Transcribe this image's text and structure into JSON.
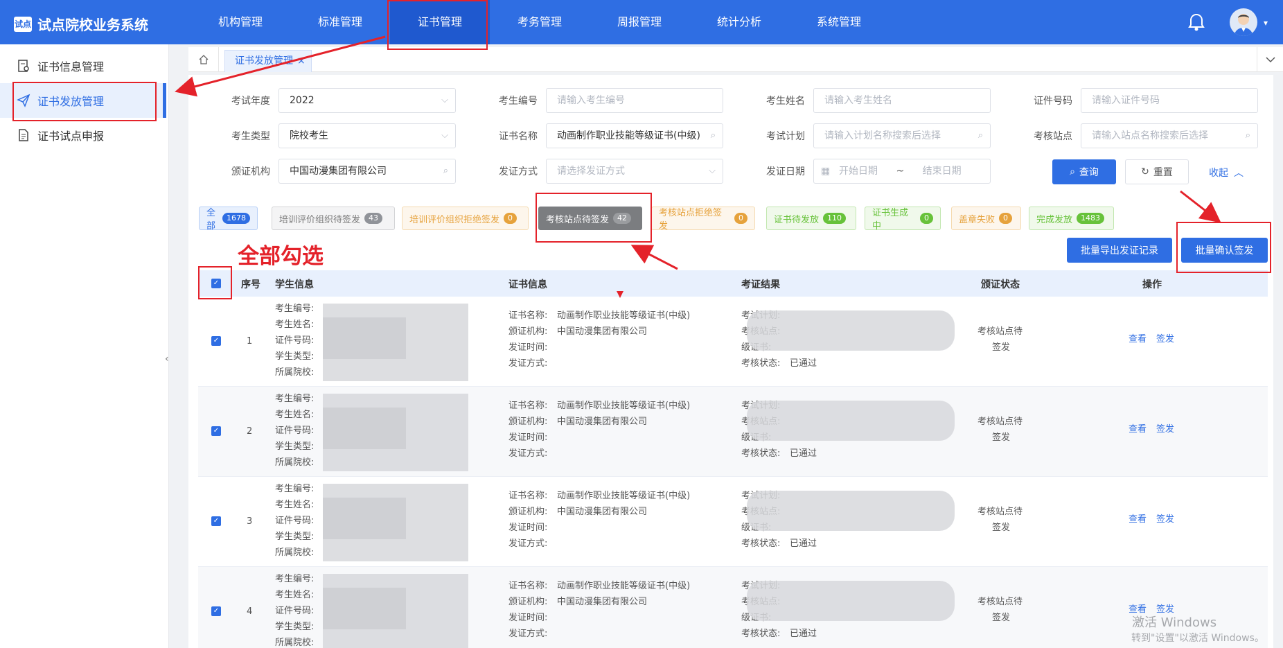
{
  "app": {
    "title": "试点院校业务系统",
    "logo_mark": "试点"
  },
  "nav": [
    {
      "label": "机构管理"
    },
    {
      "label": "标准管理"
    },
    {
      "label": "证书管理"
    },
    {
      "label": "考务管理"
    },
    {
      "label": "周报管理"
    },
    {
      "label": "统计分析"
    },
    {
      "label": "系统管理"
    }
  ],
  "sidebar": [
    {
      "label": "证书信息管理"
    },
    {
      "label": "证书发放管理"
    },
    {
      "label": "证书试点申报"
    }
  ],
  "tab": {
    "label": "证书发放管理",
    "close": "×"
  },
  "filters": {
    "year": {
      "label": "考试年度",
      "value": "2022"
    },
    "exam_no": {
      "label": "考生编号",
      "placeholder": "请输入考生编号"
    },
    "name": {
      "label": "考生姓名",
      "placeholder": "请输入考生姓名"
    },
    "cert_no": {
      "label": "证件号码",
      "placeholder": "请输入证件号码"
    },
    "type": {
      "label": "考生类型",
      "value": "院校考生"
    },
    "cert_name": {
      "label": "证书名称",
      "value": "动画制作职业技能等级证书(中级)"
    },
    "plan": {
      "label": "考试计划",
      "placeholder": "请输入计划名称搜索后选择"
    },
    "site": {
      "label": "考核站点",
      "placeholder": "请输入站点名称搜索后选择"
    },
    "org": {
      "label": "颁证机构",
      "value": "中国动漫集团有限公司"
    },
    "method": {
      "label": "发证方式",
      "placeholder": "请选择发证方式"
    },
    "date": {
      "label": "发证日期",
      "start": "开始日期",
      "sep": "~",
      "end": "结束日期"
    }
  },
  "buttons": {
    "query": "查询",
    "reset": "重置",
    "collapse": "收起",
    "export": "批量导出发证记录",
    "confirm": "批量确认签发"
  },
  "chips": [
    {
      "label": "全部",
      "count": "1678"
    },
    {
      "label": "培训评价组织待签发",
      "count": "43"
    },
    {
      "label": "培训评价组织拒绝签发",
      "count": "0"
    },
    {
      "label": "考核站点待签发",
      "count": "42"
    },
    {
      "label": "考核站点拒绝签发",
      "count": "0"
    },
    {
      "label": "证书待发放",
      "count": "110"
    },
    {
      "label": "证书生成中",
      "count": "0"
    },
    {
      "label": "盖章失败",
      "count": "0"
    },
    {
      "label": "完成发放",
      "count": "1483"
    }
  ],
  "colors": {
    "primary": "#2f6ee3",
    "annotation": "#e4222a"
  },
  "annotation": "全部勾选",
  "table": {
    "headers": [
      "序号",
      "学生信息",
      "证书信息",
      "考证结果",
      "颁证状态",
      "操作"
    ],
    "student_labels": [
      "考生编号:",
      "考生姓名:",
      "证件号码:",
      "学生类型:",
      "所属院校:"
    ],
    "cert_labels": [
      "证书名称:",
      "颁证机构:",
      "发证时间:",
      "发证方式:"
    ],
    "cert_name": "动画制作职业技能等级证书(中级)",
    "cert_org": "中国动漫集团有限公司",
    "result_labels": [
      "考试计划:",
      "考核站点:",
      "级证书:"
    ],
    "result_status_label": "考核状态:",
    "result_status": "已通过",
    "status_line1": "考核站点待",
    "status_line2": "签发",
    "action_view": "查看",
    "action_sign": "签发",
    "rows": [
      {
        "no": "1"
      },
      {
        "no": "2"
      },
      {
        "no": "3"
      },
      {
        "no": "4"
      }
    ]
  },
  "watermark": {
    "line1": "激活 Windows",
    "line2": "转到\"设置\"以激活 Windows。"
  }
}
